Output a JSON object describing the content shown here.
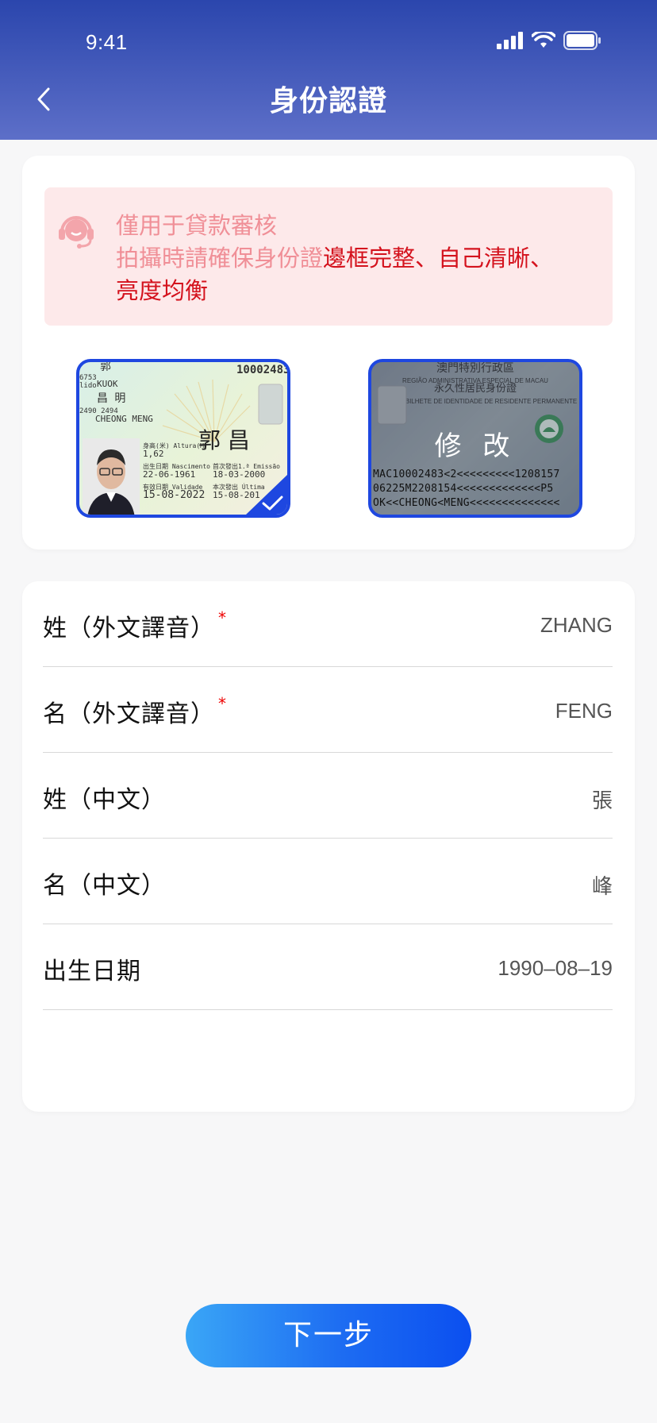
{
  "status_bar": {
    "time": "9:41"
  },
  "header": {
    "title": "身份認證",
    "back_icon": "chevron-left-icon"
  },
  "notice": {
    "line1": "僅用于貸款審核",
    "line2_prefix": "拍攝時請確保身份證",
    "line2_emphasis": "邊框完整、自己清晰、",
    "line3_emphasis": "亮度均衡",
    "icon": "customer-service-icon",
    "colors": {
      "bg": "#fde9ea",
      "text": "#f08f97",
      "emphasis": "#d4121d"
    }
  },
  "id_front": {
    "number": "10002483",
    "surname_cn": "郭",
    "surname_code": "6753",
    "apelido_label": "lido",
    "surname_pt": "KUOK",
    "given_cn": "昌 明",
    "given_code": "2490 2494",
    "given_pt": "CHEONG MENG",
    "height_label": "身高(米) Altura(M)",
    "height": "1,62",
    "dob_label": "出生日期 Nascimento",
    "dob": "22-06-1961",
    "issue_label": "首次發出1.ª Emissão",
    "issue": "18-03-2000",
    "validity_label": "有效日期 Validade",
    "validity": "15-08-2022",
    "this_issue_label": "本次發出 Última",
    "this_issue": "15-08-201",
    "signature": "郭 昌",
    "selected": true
  },
  "id_back": {
    "title_cn": "澳門特別行政區",
    "title_pt": "REGIÃO ADMINISTRATIVA ESPECIAL DE MACAU",
    "sub_cn": "永久性居民身份證",
    "sub_pt": "BILHETE DE IDENTIDADE DE RESIDENTE PERMANENTE",
    "mrz_line1": "MAC10002483<2<<<<<<<<<1208157",
    "mrz_line2": "06225M2208154<<<<<<<<<<<<<P5",
    "mrz_line3": "OK<<CHEONG<MENG<<<<<<<<<<<<<<",
    "edit_label": "修 改"
  },
  "form": {
    "rows": [
      {
        "label": "姓（外文譯音）",
        "required": true,
        "value": "ZHANG"
      },
      {
        "label": "名（外文譯音）",
        "required": true,
        "value": "FENG"
      },
      {
        "label": "姓（中文）",
        "required": false,
        "value": "張"
      },
      {
        "label": "名（中文）",
        "required": false,
        "value": "峰"
      },
      {
        "label": "出生日期",
        "required": false,
        "value": "1990–08–19"
      }
    ],
    "required_mark": "*"
  },
  "next_button": {
    "label": "下一步"
  }
}
